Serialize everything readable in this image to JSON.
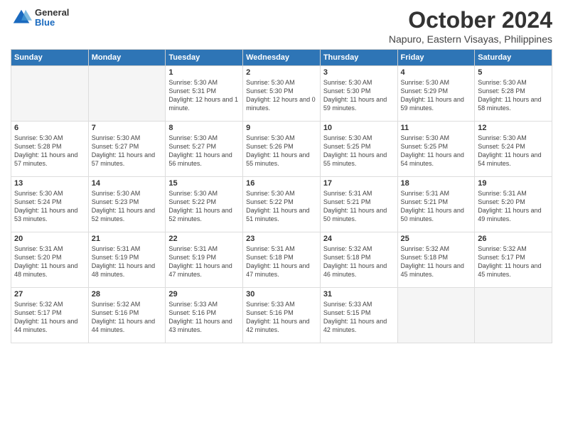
{
  "logo": {
    "general": "General",
    "blue": "Blue"
  },
  "title": "October 2024",
  "subtitle": "Napuro, Eastern Visayas, Philippines",
  "days_of_week": [
    "Sunday",
    "Monday",
    "Tuesday",
    "Wednesday",
    "Thursday",
    "Friday",
    "Saturday"
  ],
  "weeks": [
    [
      {
        "day": "",
        "empty": true
      },
      {
        "day": "",
        "empty": true
      },
      {
        "day": "1",
        "sunrise": "5:30 AM",
        "sunset": "5:31 PM",
        "daylight": "12 hours and 1 minute."
      },
      {
        "day": "2",
        "sunrise": "5:30 AM",
        "sunset": "5:30 PM",
        "daylight": "12 hours and 0 minutes."
      },
      {
        "day": "3",
        "sunrise": "5:30 AM",
        "sunset": "5:30 PM",
        "daylight": "11 hours and 59 minutes."
      },
      {
        "day": "4",
        "sunrise": "5:30 AM",
        "sunset": "5:29 PM",
        "daylight": "11 hours and 59 minutes."
      },
      {
        "day": "5",
        "sunrise": "5:30 AM",
        "sunset": "5:28 PM",
        "daylight": "11 hours and 58 minutes."
      }
    ],
    [
      {
        "day": "6",
        "sunrise": "5:30 AM",
        "sunset": "5:28 PM",
        "daylight": "11 hours and 57 minutes."
      },
      {
        "day": "7",
        "sunrise": "5:30 AM",
        "sunset": "5:27 PM",
        "daylight": "11 hours and 57 minutes."
      },
      {
        "day": "8",
        "sunrise": "5:30 AM",
        "sunset": "5:27 PM",
        "daylight": "11 hours and 56 minutes."
      },
      {
        "day": "9",
        "sunrise": "5:30 AM",
        "sunset": "5:26 PM",
        "daylight": "11 hours and 55 minutes."
      },
      {
        "day": "10",
        "sunrise": "5:30 AM",
        "sunset": "5:25 PM",
        "daylight": "11 hours and 55 minutes."
      },
      {
        "day": "11",
        "sunrise": "5:30 AM",
        "sunset": "5:25 PM",
        "daylight": "11 hours and 54 minutes."
      },
      {
        "day": "12",
        "sunrise": "5:30 AM",
        "sunset": "5:24 PM",
        "daylight": "11 hours and 54 minutes."
      }
    ],
    [
      {
        "day": "13",
        "sunrise": "5:30 AM",
        "sunset": "5:24 PM",
        "daylight": "11 hours and 53 minutes."
      },
      {
        "day": "14",
        "sunrise": "5:30 AM",
        "sunset": "5:23 PM",
        "daylight": "11 hours and 52 minutes."
      },
      {
        "day": "15",
        "sunrise": "5:30 AM",
        "sunset": "5:22 PM",
        "daylight": "11 hours and 52 minutes."
      },
      {
        "day": "16",
        "sunrise": "5:30 AM",
        "sunset": "5:22 PM",
        "daylight": "11 hours and 51 minutes."
      },
      {
        "day": "17",
        "sunrise": "5:31 AM",
        "sunset": "5:21 PM",
        "daylight": "11 hours and 50 minutes."
      },
      {
        "day": "18",
        "sunrise": "5:31 AM",
        "sunset": "5:21 PM",
        "daylight": "11 hours and 50 minutes."
      },
      {
        "day": "19",
        "sunrise": "5:31 AM",
        "sunset": "5:20 PM",
        "daylight": "11 hours and 49 minutes."
      }
    ],
    [
      {
        "day": "20",
        "sunrise": "5:31 AM",
        "sunset": "5:20 PM",
        "daylight": "11 hours and 48 minutes."
      },
      {
        "day": "21",
        "sunrise": "5:31 AM",
        "sunset": "5:19 PM",
        "daylight": "11 hours and 48 minutes."
      },
      {
        "day": "22",
        "sunrise": "5:31 AM",
        "sunset": "5:19 PM",
        "daylight": "11 hours and 47 minutes."
      },
      {
        "day": "23",
        "sunrise": "5:31 AM",
        "sunset": "5:18 PM",
        "daylight": "11 hours and 47 minutes."
      },
      {
        "day": "24",
        "sunrise": "5:32 AM",
        "sunset": "5:18 PM",
        "daylight": "11 hours and 46 minutes."
      },
      {
        "day": "25",
        "sunrise": "5:32 AM",
        "sunset": "5:18 PM",
        "daylight": "11 hours and 45 minutes."
      },
      {
        "day": "26",
        "sunrise": "5:32 AM",
        "sunset": "5:17 PM",
        "daylight": "11 hours and 45 minutes."
      }
    ],
    [
      {
        "day": "27",
        "sunrise": "5:32 AM",
        "sunset": "5:17 PM",
        "daylight": "11 hours and 44 minutes."
      },
      {
        "day": "28",
        "sunrise": "5:32 AM",
        "sunset": "5:16 PM",
        "daylight": "11 hours and 44 minutes."
      },
      {
        "day": "29",
        "sunrise": "5:33 AM",
        "sunset": "5:16 PM",
        "daylight": "11 hours and 43 minutes."
      },
      {
        "day": "30",
        "sunrise": "5:33 AM",
        "sunset": "5:16 PM",
        "daylight": "11 hours and 42 minutes."
      },
      {
        "day": "31",
        "sunrise": "5:33 AM",
        "sunset": "5:15 PM",
        "daylight": "11 hours and 42 minutes."
      },
      {
        "day": "",
        "empty": true
      },
      {
        "day": "",
        "empty": true
      }
    ]
  ]
}
